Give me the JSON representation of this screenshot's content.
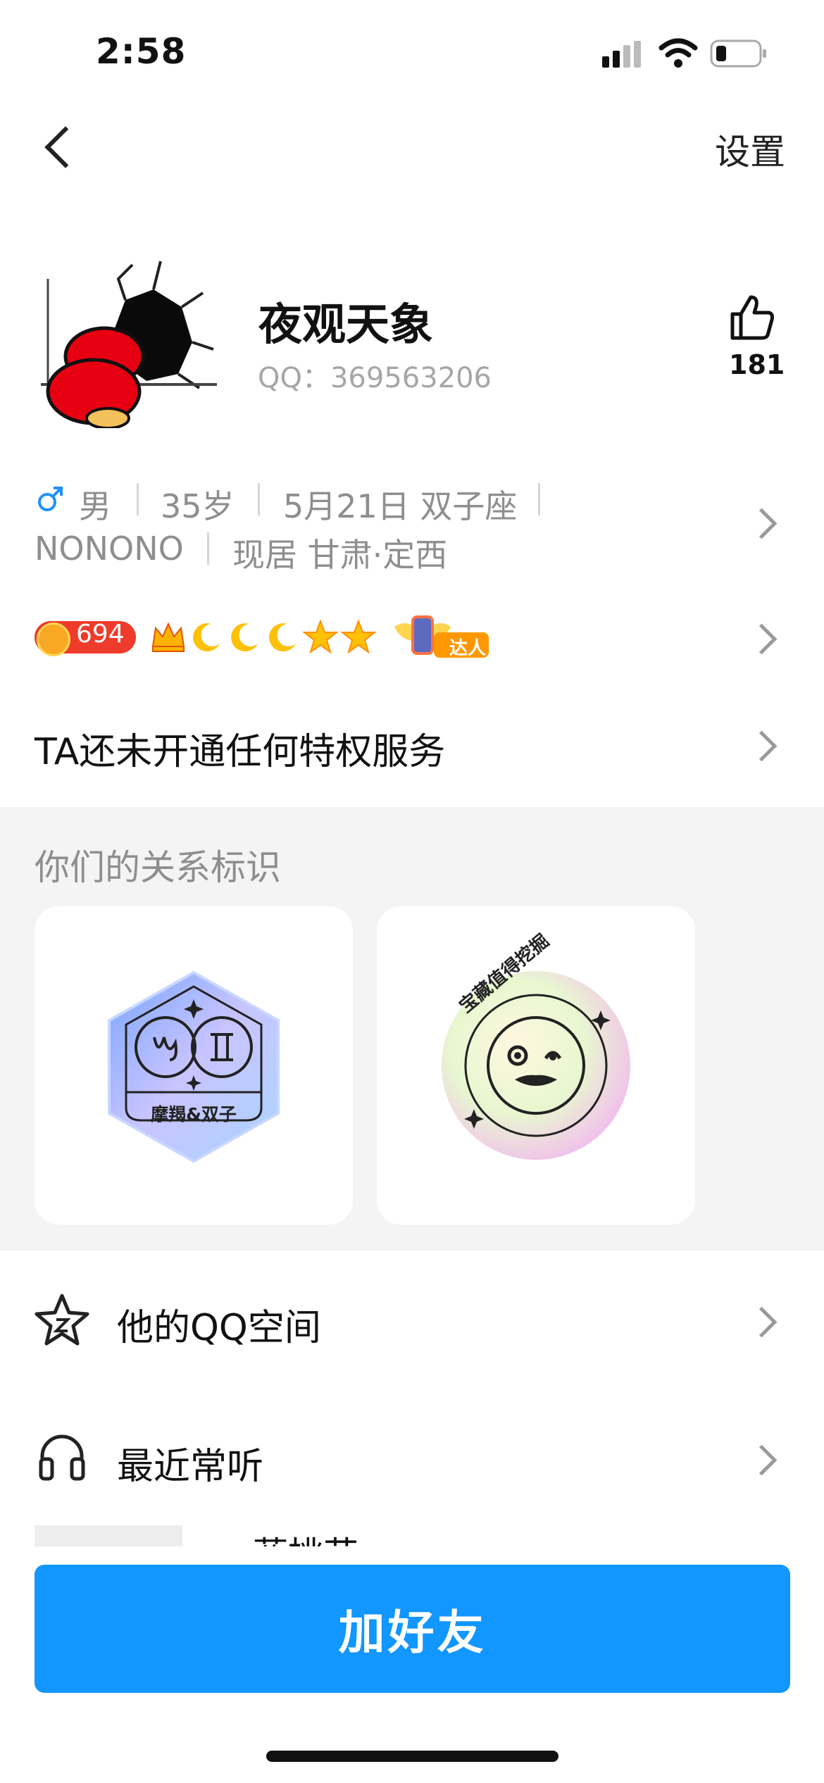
{
  "status_bar": {
    "time": "2:58"
  },
  "nav": {
    "settings": "设置"
  },
  "profile": {
    "name": "夜观天象",
    "qq_label": "QQ：369563206",
    "likes": "181"
  },
  "info": {
    "gender": "男",
    "age": "35岁",
    "birthday": "5月21日 双子座",
    "company": "NONONO",
    "location": "现居 甘肃·定西"
  },
  "badges": {
    "level": "694",
    "expert": "达人"
  },
  "privilege": {
    "text": "TA还未开通任何特权服务"
  },
  "relationship": {
    "title": "你们的关系标识",
    "card1_label": "摩羯&双子",
    "card2_label": "宝藏值得挖掘"
  },
  "menu": {
    "qzone": "他的QQ空间",
    "recent_music": "最近常听",
    "partial_song": "蓝桃花"
  },
  "action": {
    "add_friend": "加好友"
  },
  "colors": {
    "accent": "#1296ff",
    "level_badge": "#ef3b2b"
  }
}
